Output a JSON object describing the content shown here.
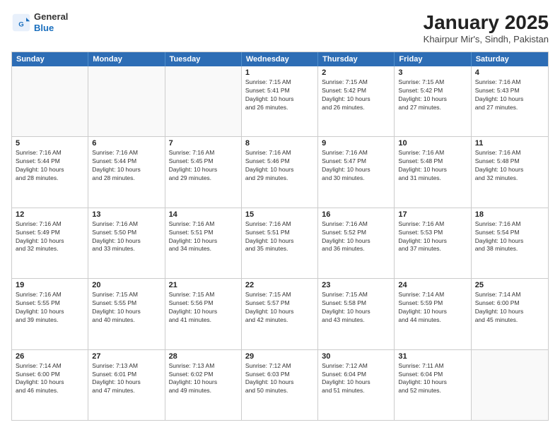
{
  "header": {
    "logo": {
      "general": "General",
      "blue": "Blue"
    },
    "title": "January 2025",
    "subtitle": "Khairpur Mir's, Sindh, Pakistan"
  },
  "calendar": {
    "weekdays": [
      "Sunday",
      "Monday",
      "Tuesday",
      "Wednesday",
      "Thursday",
      "Friday",
      "Saturday"
    ],
    "rows": [
      [
        {
          "day": "",
          "info": "",
          "empty": true
        },
        {
          "day": "",
          "info": "",
          "empty": true
        },
        {
          "day": "",
          "info": "",
          "empty": true
        },
        {
          "day": "1",
          "info": "Sunrise: 7:15 AM\nSunset: 5:41 PM\nDaylight: 10 hours\nand 26 minutes."
        },
        {
          "day": "2",
          "info": "Sunrise: 7:15 AM\nSunset: 5:42 PM\nDaylight: 10 hours\nand 26 minutes."
        },
        {
          "day": "3",
          "info": "Sunrise: 7:15 AM\nSunset: 5:42 PM\nDaylight: 10 hours\nand 27 minutes."
        },
        {
          "day": "4",
          "info": "Sunrise: 7:16 AM\nSunset: 5:43 PM\nDaylight: 10 hours\nand 27 minutes."
        }
      ],
      [
        {
          "day": "5",
          "info": "Sunrise: 7:16 AM\nSunset: 5:44 PM\nDaylight: 10 hours\nand 28 minutes."
        },
        {
          "day": "6",
          "info": "Sunrise: 7:16 AM\nSunset: 5:44 PM\nDaylight: 10 hours\nand 28 minutes."
        },
        {
          "day": "7",
          "info": "Sunrise: 7:16 AM\nSunset: 5:45 PM\nDaylight: 10 hours\nand 29 minutes."
        },
        {
          "day": "8",
          "info": "Sunrise: 7:16 AM\nSunset: 5:46 PM\nDaylight: 10 hours\nand 29 minutes."
        },
        {
          "day": "9",
          "info": "Sunrise: 7:16 AM\nSunset: 5:47 PM\nDaylight: 10 hours\nand 30 minutes."
        },
        {
          "day": "10",
          "info": "Sunrise: 7:16 AM\nSunset: 5:48 PM\nDaylight: 10 hours\nand 31 minutes."
        },
        {
          "day": "11",
          "info": "Sunrise: 7:16 AM\nSunset: 5:48 PM\nDaylight: 10 hours\nand 32 minutes."
        }
      ],
      [
        {
          "day": "12",
          "info": "Sunrise: 7:16 AM\nSunset: 5:49 PM\nDaylight: 10 hours\nand 32 minutes."
        },
        {
          "day": "13",
          "info": "Sunrise: 7:16 AM\nSunset: 5:50 PM\nDaylight: 10 hours\nand 33 minutes."
        },
        {
          "day": "14",
          "info": "Sunrise: 7:16 AM\nSunset: 5:51 PM\nDaylight: 10 hours\nand 34 minutes."
        },
        {
          "day": "15",
          "info": "Sunrise: 7:16 AM\nSunset: 5:51 PM\nDaylight: 10 hours\nand 35 minutes."
        },
        {
          "day": "16",
          "info": "Sunrise: 7:16 AM\nSunset: 5:52 PM\nDaylight: 10 hours\nand 36 minutes."
        },
        {
          "day": "17",
          "info": "Sunrise: 7:16 AM\nSunset: 5:53 PM\nDaylight: 10 hours\nand 37 minutes."
        },
        {
          "day": "18",
          "info": "Sunrise: 7:16 AM\nSunset: 5:54 PM\nDaylight: 10 hours\nand 38 minutes."
        }
      ],
      [
        {
          "day": "19",
          "info": "Sunrise: 7:16 AM\nSunset: 5:55 PM\nDaylight: 10 hours\nand 39 minutes."
        },
        {
          "day": "20",
          "info": "Sunrise: 7:15 AM\nSunset: 5:55 PM\nDaylight: 10 hours\nand 40 minutes."
        },
        {
          "day": "21",
          "info": "Sunrise: 7:15 AM\nSunset: 5:56 PM\nDaylight: 10 hours\nand 41 minutes."
        },
        {
          "day": "22",
          "info": "Sunrise: 7:15 AM\nSunset: 5:57 PM\nDaylight: 10 hours\nand 42 minutes."
        },
        {
          "day": "23",
          "info": "Sunrise: 7:15 AM\nSunset: 5:58 PM\nDaylight: 10 hours\nand 43 minutes."
        },
        {
          "day": "24",
          "info": "Sunrise: 7:14 AM\nSunset: 5:59 PM\nDaylight: 10 hours\nand 44 minutes."
        },
        {
          "day": "25",
          "info": "Sunrise: 7:14 AM\nSunset: 6:00 PM\nDaylight: 10 hours\nand 45 minutes."
        }
      ],
      [
        {
          "day": "26",
          "info": "Sunrise: 7:14 AM\nSunset: 6:00 PM\nDaylight: 10 hours\nand 46 minutes."
        },
        {
          "day": "27",
          "info": "Sunrise: 7:13 AM\nSunset: 6:01 PM\nDaylight: 10 hours\nand 47 minutes."
        },
        {
          "day": "28",
          "info": "Sunrise: 7:13 AM\nSunset: 6:02 PM\nDaylight: 10 hours\nand 49 minutes."
        },
        {
          "day": "29",
          "info": "Sunrise: 7:12 AM\nSunset: 6:03 PM\nDaylight: 10 hours\nand 50 minutes."
        },
        {
          "day": "30",
          "info": "Sunrise: 7:12 AM\nSunset: 6:04 PM\nDaylight: 10 hours\nand 51 minutes."
        },
        {
          "day": "31",
          "info": "Sunrise: 7:11 AM\nSunset: 6:04 PM\nDaylight: 10 hours\nand 52 minutes."
        },
        {
          "day": "",
          "info": "",
          "empty": true
        }
      ]
    ]
  }
}
